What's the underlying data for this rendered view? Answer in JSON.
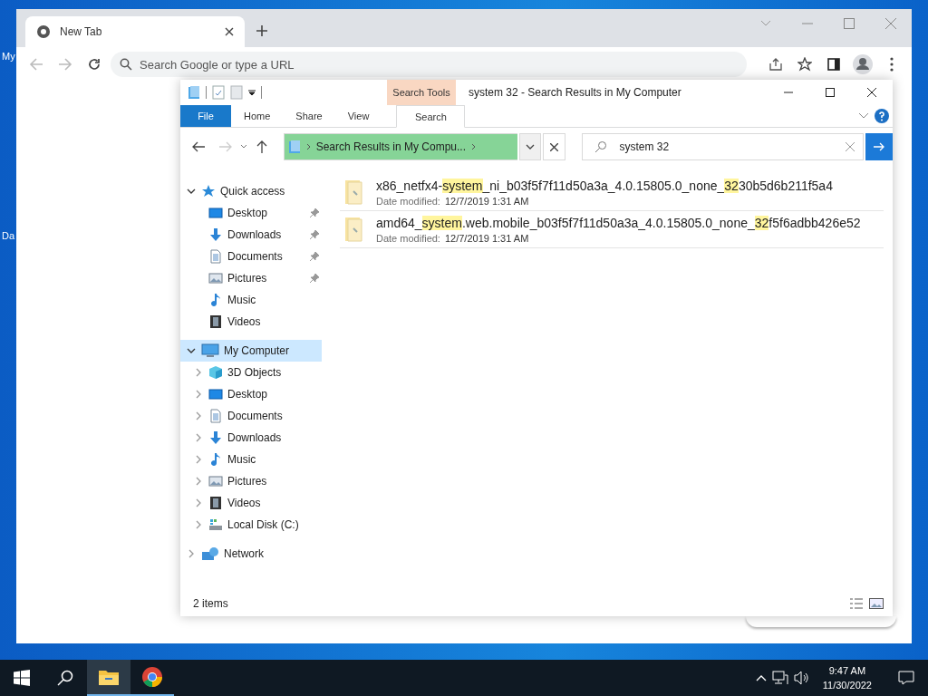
{
  "desktop_icons": [
    {
      "label": "My"
    },
    {
      "label": "Da"
    }
  ],
  "browser": {
    "tab": {
      "title": "New Tab"
    },
    "omnibox": {
      "placeholder": "Search Google or type a URL"
    }
  },
  "explorer": {
    "context_tab": "Search Tools",
    "title": "system 32 - Search Results in My Computer",
    "ribbon_tabs": [
      {
        "label": "File",
        "kind": "file",
        "selected": false
      },
      {
        "label": "Home",
        "kind": "normal",
        "selected": false
      },
      {
        "label": "Share",
        "kind": "normal",
        "selected": false
      },
      {
        "label": "View",
        "kind": "normal",
        "selected": false
      },
      {
        "label": "Search",
        "kind": "context",
        "selected": true
      }
    ],
    "address": {
      "path": "Search Results in My Compu...",
      "level": 1
    },
    "search": {
      "value": "system 32"
    },
    "nav": [
      {
        "label": "Quick access",
        "kind": "star",
        "expanded": true,
        "selected": false,
        "children": [
          {
            "label": "Desktop",
            "kind": "desktop",
            "pinned": true,
            "selected": false
          },
          {
            "label": "Downloads",
            "kind": "download",
            "pinned": true,
            "selected": false
          },
          {
            "label": "Documents",
            "kind": "document",
            "pinned": true,
            "selected": false
          },
          {
            "label": "Pictures",
            "kind": "picture",
            "pinned": true,
            "selected": false
          },
          {
            "label": "Music",
            "kind": "music",
            "pinned": false,
            "selected": false
          },
          {
            "label": "Videos",
            "kind": "video",
            "pinned": false,
            "selected": false
          }
        ]
      },
      {
        "label": "My Computer",
        "kind": "computer",
        "expanded": true,
        "selected": true,
        "children": [
          {
            "label": "3D Objects",
            "kind": "cube",
            "expanded": false,
            "selected": false
          },
          {
            "label": "Desktop",
            "kind": "desktop",
            "expanded": false,
            "selected": false
          },
          {
            "label": "Documents",
            "kind": "document",
            "expanded": false,
            "selected": false
          },
          {
            "label": "Downloads",
            "kind": "download",
            "expanded": false,
            "selected": false
          },
          {
            "label": "Music",
            "kind": "music",
            "expanded": false,
            "selected": false
          },
          {
            "label": "Pictures",
            "kind": "picture",
            "expanded": false,
            "selected": false
          },
          {
            "label": "Videos",
            "kind": "video",
            "expanded": false,
            "selected": false
          },
          {
            "label": "Local Disk (C:)",
            "kind": "disk",
            "expanded": false,
            "selected": false
          }
        ]
      },
      {
        "label": "Network",
        "kind": "network",
        "expanded": false,
        "selected": false
      }
    ],
    "results": [
      {
        "name": [
          {
            "text": "x86_netfx4-",
            "highlighted": false
          },
          {
            "text": "system",
            "highlighted": true
          },
          {
            "text": "_ni_b03f5f7f11d50a3a_4.0.15805.0_none_",
            "highlighted": false
          },
          {
            "text": "32",
            "highlighted": true
          },
          {
            "text": "30b5d6b211f5a4",
            "highlighted": false
          }
        ],
        "date_label": "Date modified:",
        "date": "12/7/2019 1:31 AM"
      },
      {
        "name": [
          {
            "text": "amd64_",
            "highlighted": false
          },
          {
            "text": "system",
            "highlighted": true
          },
          {
            "text": ".web.mobile_b03f5f7f11d50a3a_4.0.15805.0_none_",
            "highlighted": false
          },
          {
            "text": "32",
            "highlighted": true
          },
          {
            "text": "f5f6adbb426e52",
            "highlighted": false
          }
        ],
        "date_label": "Date modified:",
        "date": "12/7/2019 1:31 AM"
      }
    ],
    "status": "2 items"
  },
  "taskbar": {
    "apps": [
      {
        "kind": "explorer",
        "selected": true
      },
      {
        "kind": "chrome",
        "selected": false
      }
    ],
    "time": "9:47 AM",
    "date": "11/30/2022"
  }
}
